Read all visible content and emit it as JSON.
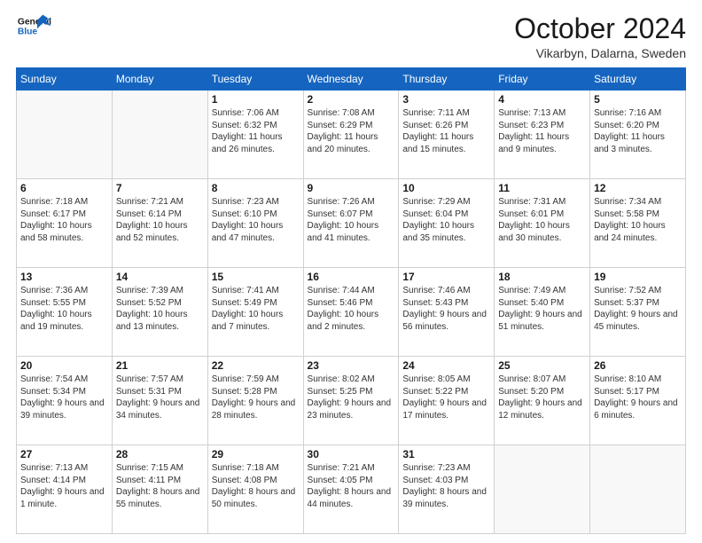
{
  "header": {
    "logo_general": "General",
    "logo_blue": "Blue",
    "month": "October 2024",
    "location": "Vikarbyn, Dalarna, Sweden"
  },
  "days_of_week": [
    "Sunday",
    "Monday",
    "Tuesday",
    "Wednesday",
    "Thursday",
    "Friday",
    "Saturday"
  ],
  "weeks": [
    [
      {
        "day": "",
        "info": ""
      },
      {
        "day": "",
        "info": ""
      },
      {
        "day": "1",
        "info": "Sunrise: 7:06 AM\nSunset: 6:32 PM\nDaylight: 11 hours and 26 minutes."
      },
      {
        "day": "2",
        "info": "Sunrise: 7:08 AM\nSunset: 6:29 PM\nDaylight: 11 hours and 20 minutes."
      },
      {
        "day": "3",
        "info": "Sunrise: 7:11 AM\nSunset: 6:26 PM\nDaylight: 11 hours and 15 minutes."
      },
      {
        "day": "4",
        "info": "Sunrise: 7:13 AM\nSunset: 6:23 PM\nDaylight: 11 hours and 9 minutes."
      },
      {
        "day": "5",
        "info": "Sunrise: 7:16 AM\nSunset: 6:20 PM\nDaylight: 11 hours and 3 minutes."
      }
    ],
    [
      {
        "day": "6",
        "info": "Sunrise: 7:18 AM\nSunset: 6:17 PM\nDaylight: 10 hours and 58 minutes."
      },
      {
        "day": "7",
        "info": "Sunrise: 7:21 AM\nSunset: 6:14 PM\nDaylight: 10 hours and 52 minutes."
      },
      {
        "day": "8",
        "info": "Sunrise: 7:23 AM\nSunset: 6:10 PM\nDaylight: 10 hours and 47 minutes."
      },
      {
        "day": "9",
        "info": "Sunrise: 7:26 AM\nSunset: 6:07 PM\nDaylight: 10 hours and 41 minutes."
      },
      {
        "day": "10",
        "info": "Sunrise: 7:29 AM\nSunset: 6:04 PM\nDaylight: 10 hours and 35 minutes."
      },
      {
        "day": "11",
        "info": "Sunrise: 7:31 AM\nSunset: 6:01 PM\nDaylight: 10 hours and 30 minutes."
      },
      {
        "day": "12",
        "info": "Sunrise: 7:34 AM\nSunset: 5:58 PM\nDaylight: 10 hours and 24 minutes."
      }
    ],
    [
      {
        "day": "13",
        "info": "Sunrise: 7:36 AM\nSunset: 5:55 PM\nDaylight: 10 hours and 19 minutes."
      },
      {
        "day": "14",
        "info": "Sunrise: 7:39 AM\nSunset: 5:52 PM\nDaylight: 10 hours and 13 minutes."
      },
      {
        "day": "15",
        "info": "Sunrise: 7:41 AM\nSunset: 5:49 PM\nDaylight: 10 hours and 7 minutes."
      },
      {
        "day": "16",
        "info": "Sunrise: 7:44 AM\nSunset: 5:46 PM\nDaylight: 10 hours and 2 minutes."
      },
      {
        "day": "17",
        "info": "Sunrise: 7:46 AM\nSunset: 5:43 PM\nDaylight: 9 hours and 56 minutes."
      },
      {
        "day": "18",
        "info": "Sunrise: 7:49 AM\nSunset: 5:40 PM\nDaylight: 9 hours and 51 minutes."
      },
      {
        "day": "19",
        "info": "Sunrise: 7:52 AM\nSunset: 5:37 PM\nDaylight: 9 hours and 45 minutes."
      }
    ],
    [
      {
        "day": "20",
        "info": "Sunrise: 7:54 AM\nSunset: 5:34 PM\nDaylight: 9 hours and 39 minutes."
      },
      {
        "day": "21",
        "info": "Sunrise: 7:57 AM\nSunset: 5:31 PM\nDaylight: 9 hours and 34 minutes."
      },
      {
        "day": "22",
        "info": "Sunrise: 7:59 AM\nSunset: 5:28 PM\nDaylight: 9 hours and 28 minutes."
      },
      {
        "day": "23",
        "info": "Sunrise: 8:02 AM\nSunset: 5:25 PM\nDaylight: 9 hours and 23 minutes."
      },
      {
        "day": "24",
        "info": "Sunrise: 8:05 AM\nSunset: 5:22 PM\nDaylight: 9 hours and 17 minutes."
      },
      {
        "day": "25",
        "info": "Sunrise: 8:07 AM\nSunset: 5:20 PM\nDaylight: 9 hours and 12 minutes."
      },
      {
        "day": "26",
        "info": "Sunrise: 8:10 AM\nSunset: 5:17 PM\nDaylight: 9 hours and 6 minutes."
      }
    ],
    [
      {
        "day": "27",
        "info": "Sunrise: 7:13 AM\nSunset: 4:14 PM\nDaylight: 9 hours and 1 minute."
      },
      {
        "day": "28",
        "info": "Sunrise: 7:15 AM\nSunset: 4:11 PM\nDaylight: 8 hours and 55 minutes."
      },
      {
        "day": "29",
        "info": "Sunrise: 7:18 AM\nSunset: 4:08 PM\nDaylight: 8 hours and 50 minutes."
      },
      {
        "day": "30",
        "info": "Sunrise: 7:21 AM\nSunset: 4:05 PM\nDaylight: 8 hours and 44 minutes."
      },
      {
        "day": "31",
        "info": "Sunrise: 7:23 AM\nSunset: 4:03 PM\nDaylight: 8 hours and 39 minutes."
      },
      {
        "day": "",
        "info": ""
      },
      {
        "day": "",
        "info": ""
      }
    ]
  ]
}
